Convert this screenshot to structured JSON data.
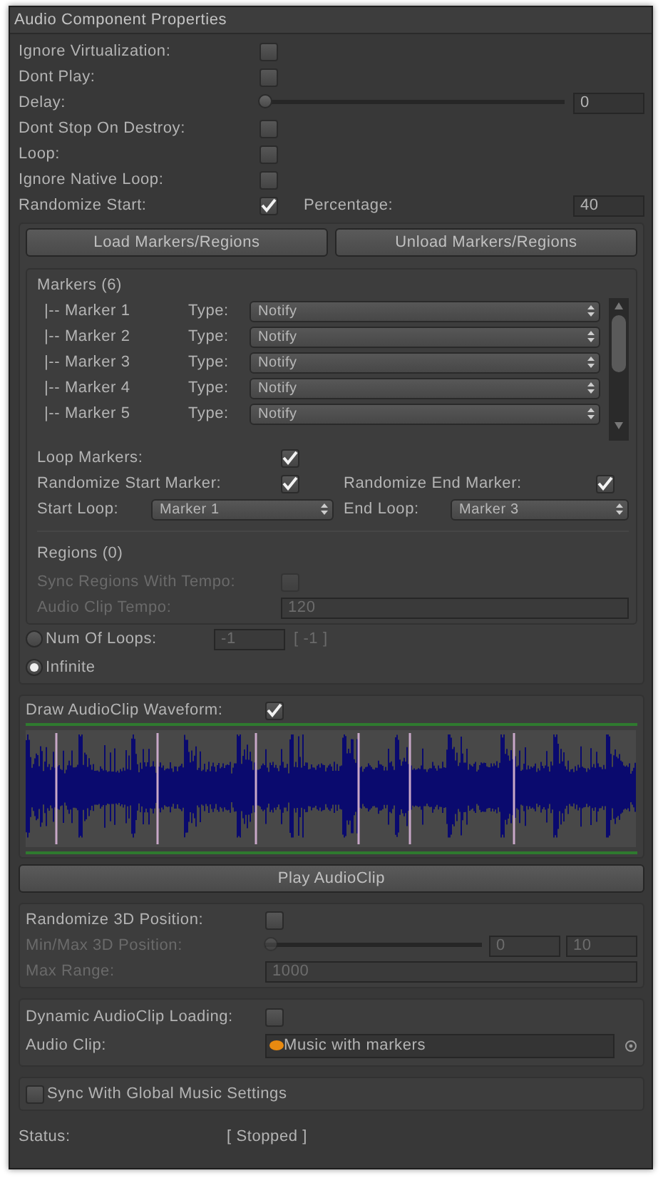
{
  "title": "Audio Component Properties",
  "settings": [
    {
      "kind": "checkbox",
      "label": "Ignore Virtualization:",
      "checked": false
    },
    {
      "kind": "checkbox",
      "label": "Dont Play:",
      "checked": false
    },
    {
      "kind": "slider",
      "label": "Delay:",
      "level": 0,
      "value": "0"
    },
    {
      "kind": "checkbox",
      "label": "Dont Stop On Destroy:",
      "checked": false
    },
    {
      "kind": "checkbox",
      "label": "Loop:",
      "checked": false
    },
    {
      "kind": "checkbox",
      "label": "Ignore Native Loop:",
      "checked": false
    },
    {
      "kind": "checkbox_field",
      "label": "Randomize Start:",
      "checked": true,
      "field_label": "Percentage:",
      "value": "40"
    }
  ],
  "marker_buttons": [
    "Load Markers/Regions",
    "Unload Markers/Regions"
  ],
  "markers": {
    "heading": "Markers (6)",
    "items": [
      {
        "name": "|-- Marker 1",
        "type_label": "Type:",
        "type": "Notify"
      },
      {
        "name": "|-- Marker 2",
        "type_label": "Type:",
        "type": "Notify"
      },
      {
        "name": "|-- Marker 3",
        "type_label": "Type:",
        "type": "Notify"
      },
      {
        "name": "|-- Marker 4",
        "type_label": "Type:",
        "type": "Notify"
      },
      {
        "name": "|-- Marker 5",
        "type_label": "Type:",
        "type": "Notify"
      }
    ]
  },
  "loop_markers": {
    "label": "Loop Markers:",
    "checked": true
  },
  "randomize_start_marker": {
    "label": "Randomize Start Marker:",
    "checked": true
  },
  "randomize_end_marker": {
    "label": "Randomize End Marker:",
    "checked": true
  },
  "start_loop": {
    "label": "Start Loop:",
    "value": "Marker 1"
  },
  "end_loop": {
    "label": "End Loop:",
    "value": "Marker 3"
  },
  "regions": {
    "heading": "Regions (0)",
    "sync": {
      "label": "Sync Regions With Tempo:",
      "checked": false,
      "disabled": true
    },
    "tempo": {
      "label": "Audio Clip Tempo:",
      "value": "120",
      "disabled": true
    }
  },
  "loops": [
    {
      "label": "Num Of Loops:",
      "selected": false,
      "value": "-1",
      "reading": "[ -1 ]",
      "disabled": true
    },
    {
      "label": "Infinite",
      "selected": true
    }
  ],
  "waveform": {
    "label": "Draw AudioClip Waveform:",
    "checked": true
  },
  "play_button": "Play AudioClip",
  "position_3d": {
    "randomize": {
      "label": "Randomize 3D Position:",
      "checked": false
    },
    "min_max": {
      "label": "Min/Max 3D Position:",
      "level": 0,
      "min": "0",
      "max": "10",
      "disabled": true
    },
    "max_range": {
      "label": "Max Range:",
      "value": "1000",
      "disabled": true
    }
  },
  "loading": {
    "dynamic": {
      "label": "Dynamic AudioClip Loading:",
      "checked": false
    },
    "clip": {
      "label": "Audio Clip:",
      "value": "Music with markers"
    }
  },
  "sync_global": {
    "label": "Sync With Global Music Settings",
    "checked": false
  },
  "status": {
    "label": "Status:",
    "value": "[ Stopped ]"
  }
}
